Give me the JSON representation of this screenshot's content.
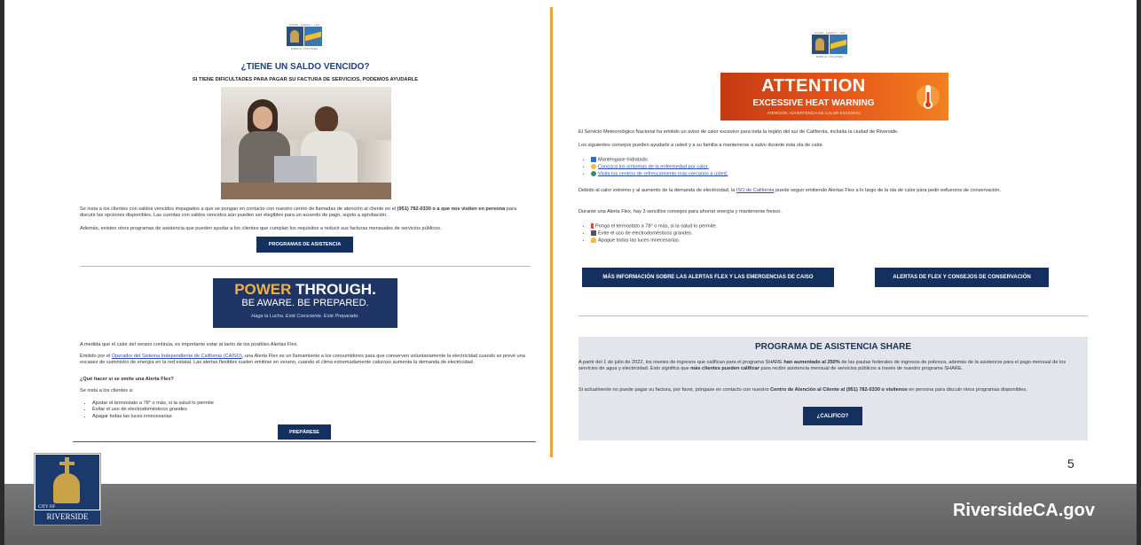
{
  "left": {
    "title": "¿TIENE UN SALDO VENCIDO?",
    "subtitle": "SI TIENE DIFICULTADES PARA PAGAR SU FACTURA DE SERVICIOS, PODEMOS AYUDARLE",
    "logo_tagline": "WATER · ENERGY · LIFE",
    "logo_name": "PUBLIC UTILITIES",
    "para1_a": "Se insta a los clientes con saldos vencidos impagados a que se pongan en contacto con nuestro centro de llamadas de atención al cliente en el ",
    "para1_bold": "(951) 782-0330 o a que nos visiten en persona",
    "para1_b": " para discutir las opciones disponibles. Las cuentas con saldos vencidos aún pueden ser elegibles para un acuerdo de pago, sujeto a aprobación.",
    "para2": "Además, existen otros programas de asistencia que pueden ayudar a los clientes que cumplan los requisitos a reducir sus facturas mensuales de servicios públicos.",
    "btn_programs": "PROGRAMAS DE ASISTENCIA",
    "power_title_a": "POWER",
    "power_title_b": " THROUGH.",
    "power_sub": "BE AWARE. BE PREPARED.",
    "power_es": "Haga la Lucha. Esté Consciente. Esté Preparado.",
    "para3": "A medida que el calor del verano continúa, es importante estar al tanto de los posibles Alertas Flex.",
    "para4_a": "Emitido por el ",
    "para4_link": "Operador del Sistema Independiente de California (CAISO)",
    "para4_b": ", una Alerta Flex es un llamamiento a los consumidores para que conserven voluntariamente la electricidad cuando se prevé una escasez de suministro de energía en la red estatal. Las alertas flexibles suelen emitirse en verano, cuando el clima extremadamente caluroso aumenta la demanda de electricidad.",
    "question": "¿Qué hacer si se emite una Alerta Flex?",
    "urge": "Se insta a los clientes a:",
    "tips": [
      "Ajustar el termostato a 78° o más, si la salud lo permite",
      "Evitar el uso de electrodomésticos grandes",
      "Apagar todas las luces innecesarias"
    ],
    "btn_prepare": "PREPÁRESE"
  },
  "right": {
    "logo_tagline": "WATER · ENERGY · LIFE",
    "logo_name": "PUBLIC UTILITIES",
    "attention": "ATTENTION",
    "heat_warning": "EXCESSIVE HEAT WARNING",
    "heat_es": "ATENCIÓN: ADVERTENCIA DE CALOR EXCESIVO",
    "para1": "El Servicio Meteorológico Nacional ha emitido un aviso de calor excesivo para toda la región del sur de California, incluida la ciudad de Riverside.",
    "para2": "Los siguientes consejos pueden ayudarle a usted y a su familia a mantenerse a salvo durante esta ola de calor.",
    "heat_tips": [
      "Manténgase hidratado.",
      "Conozca los síntomas de la enfermedad por calor.",
      "Visita los centros de refrescamiento más cercanos a usted."
    ],
    "para3_a": "Debido al calor extremo y al aumento de la demanda de electricidad, la ",
    "para3_link": "ISO de California",
    "para3_b": " puede seguir emitiendo Alertas Flex a lo largo de la ola de calor para pedir esfuerzos de conservación.",
    "para4": "Durante una Alerta Flex, hay 3 sencillos consejos para ahorrar energía y mantenerse fresco.",
    "flex_tips": [
      "Ponga el termostato a 78° o más, si la salud lo permite.",
      "Evite el uso de electrodomésticos grandes.",
      "Apague todas las luces innecesarias."
    ],
    "btn_more": "MÁS INFORMACIÓN SOBRE LAS ALERTAS FLEX Y LAS EMERGENCIAS DE CAISO",
    "btn_alerts": "ALERTAS DE FLEX  Y CONSEJOS DE CONSERVACIÓN",
    "share_title": "PROGRAMA DE ASISTENCIA SHARE",
    "share_p1_a": "A partir del 1 de julio de 2022, los niveles de ingresos que califican para el programa SHARE ",
    "share_p1_bold": "han aumentado al 250%",
    "share_p1_b": " de las pautas federales de ingresos de pobreza, además de la asistencia para el pago mensual de los servicios de agua y electricidad. Esto significa que ",
    "share_p1_bold2": "más clientes pueden calificar",
    "share_p1_c": " para recibir asistencia mensual de servicios públicos a través de nuestro programa SHARE.",
    "share_p2_a": "Si actualmente no puede pagar su factura, por favor, póngase en contacto con nuestro ",
    "share_p2_bold": "Centro de Atención al Cliente al (951) 782-0330 o visítenos",
    "share_p2_b": " en persona para discutir otros programas disponibles.",
    "btn_qualify": "¿CALIFICO?"
  },
  "footer": {
    "page_number": "5",
    "website": "RiversideCA.gov",
    "seal_city": "CITY OF",
    "seal_name": "RIVERSIDE"
  }
}
